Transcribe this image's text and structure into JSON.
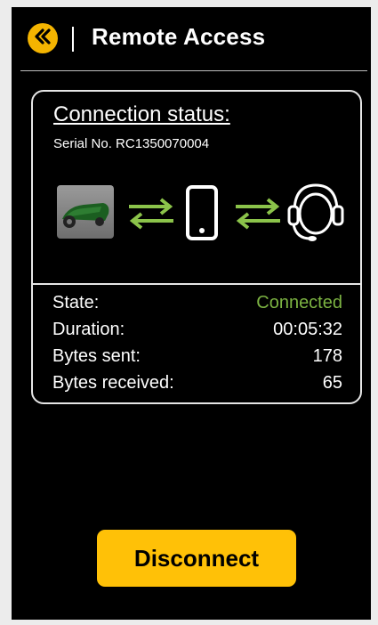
{
  "header": {
    "title": "Remote Access",
    "back_icon": "double-chevron-left-icon",
    "accent_color": "#f4b400"
  },
  "connection": {
    "title": "Connection status:",
    "serial": "Serial No. RC1350070004",
    "icons": [
      "robot-mower-icon",
      "bidirectional-arrows-icon",
      "smartphone-icon",
      "bidirectional-arrows-icon",
      "headset-support-icon"
    ],
    "arrow_color": "#8bc34a",
    "rows": [
      {
        "label": "State:",
        "value": "Connected",
        "value_color": "#7cb342"
      },
      {
        "label": "Duration:",
        "value": "00:05:32"
      },
      {
        "label": "Bytes sent:",
        "value": "178"
      },
      {
        "label": "Bytes received:",
        "value": "65"
      }
    ]
  },
  "actions": {
    "disconnect_label": "Disconnect",
    "button_color": "#ffc107"
  }
}
